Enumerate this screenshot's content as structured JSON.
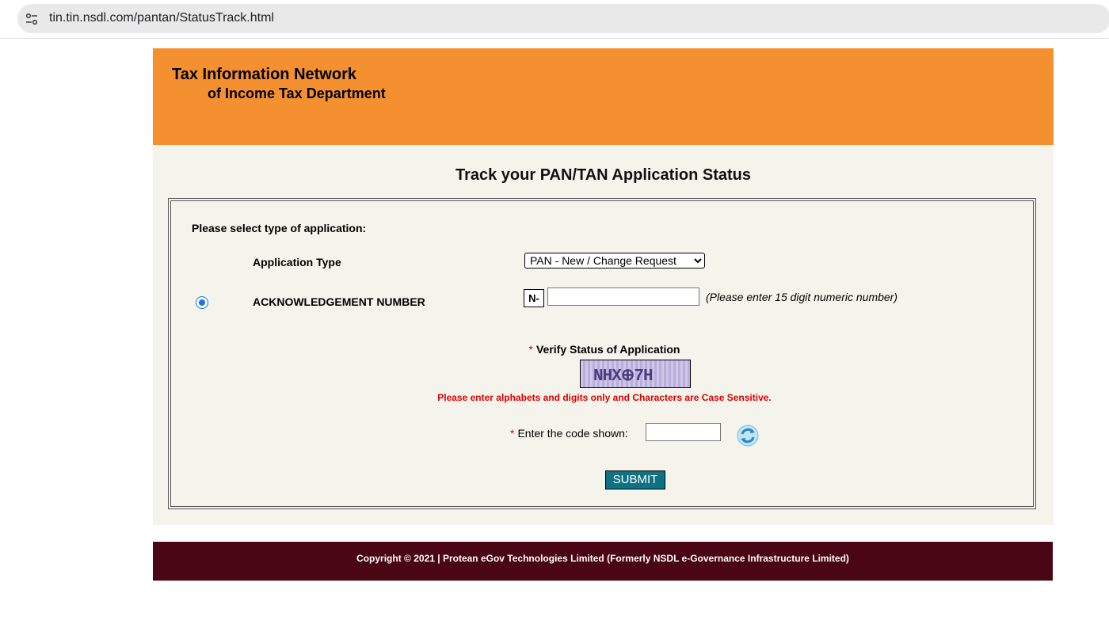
{
  "browser": {
    "url": "tin.tin.nsdl.com/pantan/StatusTrack.html",
    "site_info_icon": "tune-icon"
  },
  "header": {
    "title": "Tax Information Network",
    "subtitle": "of Income Tax Department",
    "background_color": "#f4902f"
  },
  "main": {
    "heading": "Track your PAN/TAN Application Status",
    "select_type_label": "Please select type of application:",
    "application_type_label": "Application Type",
    "application_type_selected": "PAN - New / Change Request",
    "acknowledgement_label": "ACKNOWLEDGEMENT NUMBER",
    "acknowledgement_selected": true,
    "acknowledgement_prefix": "N-",
    "acknowledgement_value": "",
    "acknowledgement_hint": "(Please enter 15 digit numeric number)",
    "required_marker": "*",
    "verify_label": "Verify Status of Application",
    "captcha_text": "NHX⊕7H",
    "case_note": "Please enter alphabets and digits only and Characters are Case Sensitive.",
    "code_label": "Enter the code shown:",
    "code_value": "",
    "refresh_icon": "refresh-icon",
    "submit_label": "SUBMIT",
    "submit_color": "#0e7283"
  },
  "footer": {
    "copyright": "Copyright © 2021 | Protean eGov Technologies Limited (Formerly NSDL e-Governance Infrastructure Limited)",
    "background_color": "#4a0614"
  }
}
